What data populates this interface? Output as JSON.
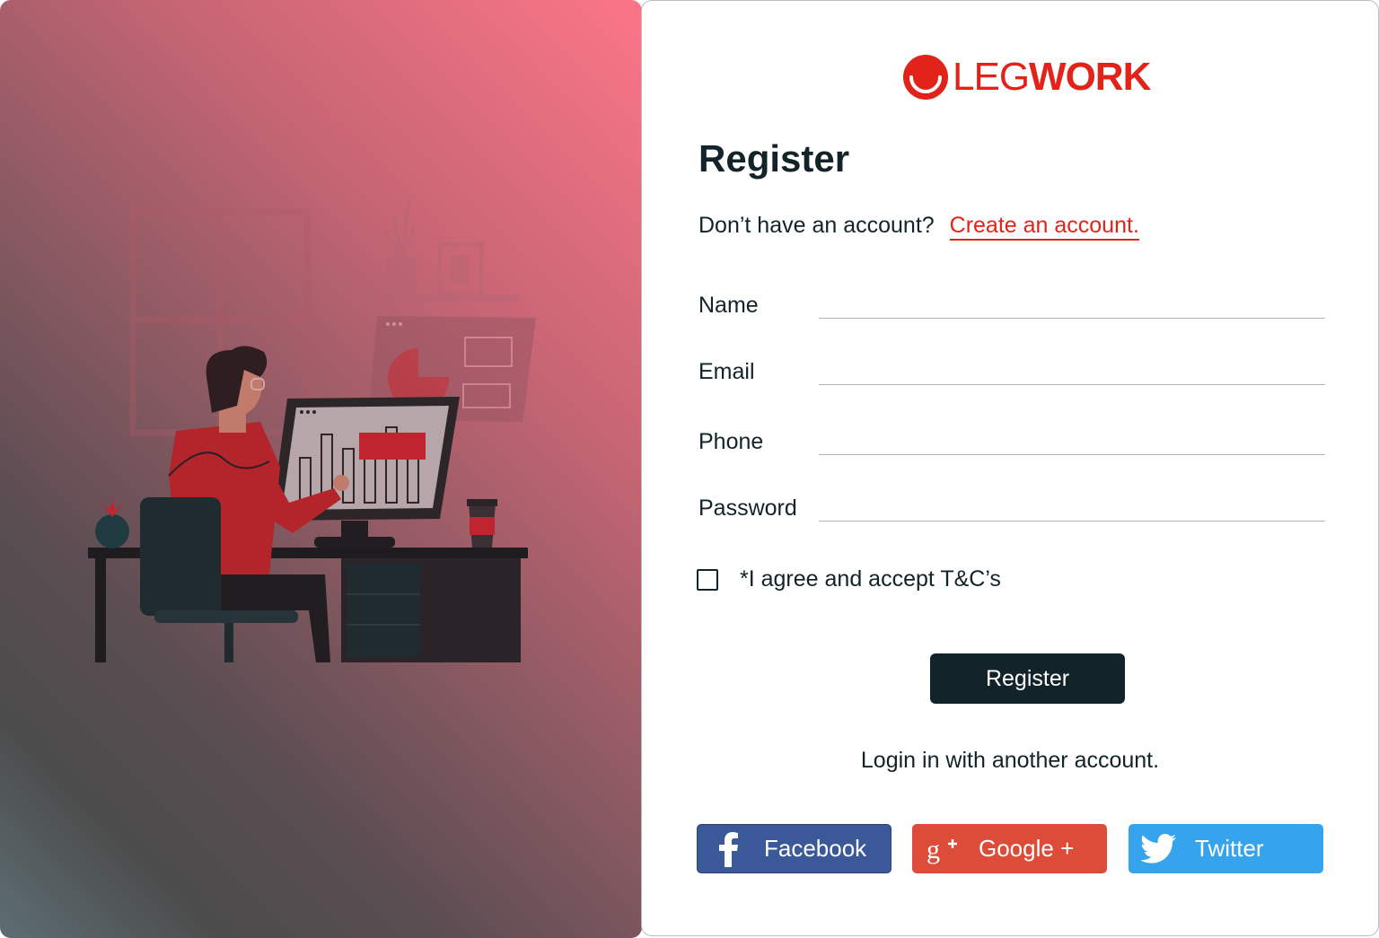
{
  "brand": {
    "name_light": "LEG",
    "name_bold": "WORK",
    "color": "#e2231a"
  },
  "form": {
    "title": "Register",
    "prompt": "Don’t have an account?",
    "create_link": "Create an account.",
    "fields": {
      "name": "Name",
      "email": "Email",
      "phone": "Phone",
      "password": "Password"
    },
    "terms": "*I agree and accept T&C’s",
    "submit": "Register",
    "alt_login": "Login in with another account."
  },
  "social": {
    "facebook": {
      "label": "Facebook",
      "color": "#3b5998",
      "icon": "facebook-icon"
    },
    "google": {
      "label": "Google +",
      "color": "#dd4b39",
      "icon": "google-plus-icon"
    },
    "twitter": {
      "label": "Twitter",
      "color": "#35a4ed",
      "icon": "twitter-icon"
    }
  },
  "colors": {
    "dark": "#13232a",
    "accent": "#e2231a"
  }
}
